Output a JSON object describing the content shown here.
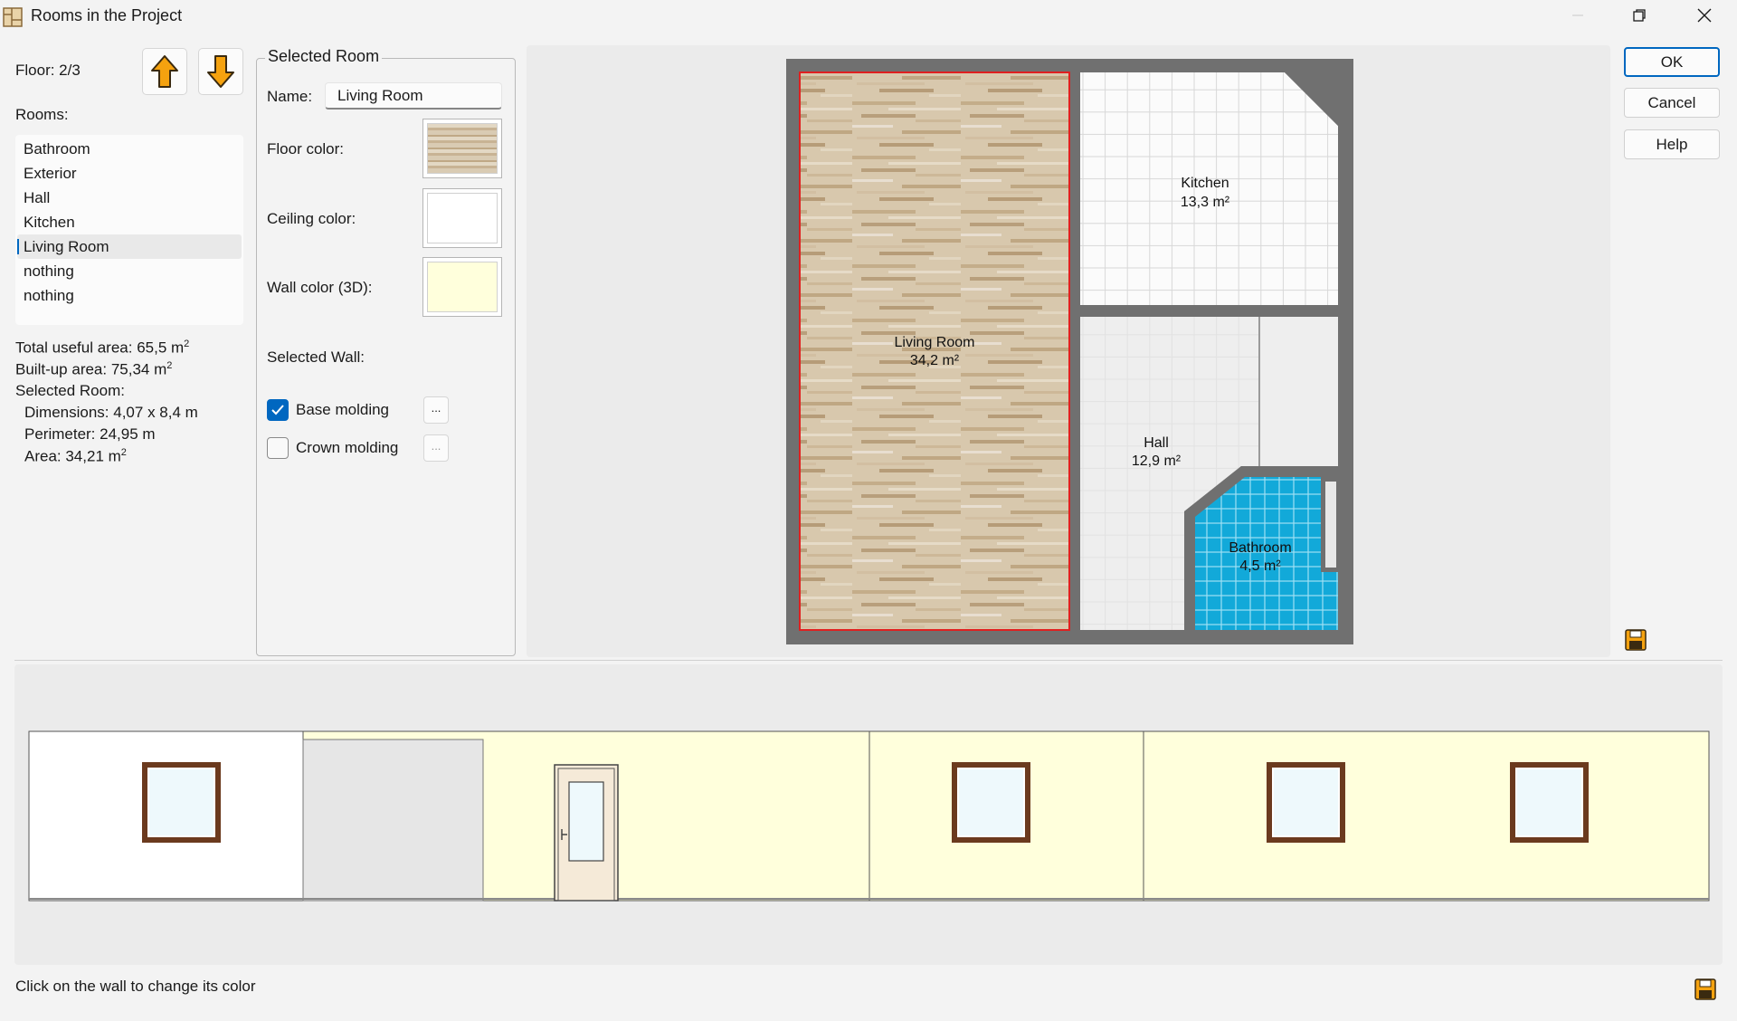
{
  "window": {
    "title": "Rooms in the Project"
  },
  "floor": {
    "label": "Floor: 2/3"
  },
  "rooms": {
    "label": "Rooms:",
    "items": [
      "Bathroom",
      "Exterior",
      "Hall",
      "Kitchen",
      "Living Room",
      "nothing",
      "nothing"
    ],
    "selected": "Living Room"
  },
  "stats": {
    "total_useful_area": "Total useful area: 65,5 m",
    "built_up_area": "Built-up area: 75,34 m",
    "selected_room": "Selected Room:",
    "dimensions": "Dimensions: 4,07 x 8,4 m",
    "perimeter": "Perimeter: 24,95 m",
    "area": "Area: 34,21 m",
    "sq": "2"
  },
  "selected_room": {
    "legend": "Selected Room",
    "name_label": "Name:",
    "name_value": "Living Room",
    "floor_color_label": "Floor color:",
    "ceiling_color_label": "Ceiling color:",
    "wall_color_label": "Wall color (3D):",
    "selected_wall_label": "Selected Wall:",
    "base_molding_label": "Base molding",
    "base_molding_checked": true,
    "crown_molding_label": "Crown molding",
    "crown_molding_checked": false,
    "dots_label": "...",
    "ceiling_color": "#ffffff",
    "wall_color": "#ffffdc"
  },
  "plan": {
    "rooms": [
      {
        "name": "Living Room",
        "area": "34,2 m²"
      },
      {
        "name": "Kitchen",
        "area": "13,3 m²"
      },
      {
        "name": "Hall",
        "area": "12,9 m²"
      },
      {
        "name": "Bathroom",
        "area": "4,5 m²"
      }
    ]
  },
  "buttons": {
    "ok": "OK",
    "cancel": "Cancel",
    "help": "Help"
  },
  "status": "Click on the wall to change its color",
  "colors": {
    "accent": "#0067c0",
    "wall_yellow": "#ffffdc",
    "bathroom_tile": "#12a9d9",
    "selection_red": "#e02020",
    "arrow_orange": "#f5a20f"
  },
  "icons": {
    "up": "arrow-up-icon",
    "down": "arrow-down-icon",
    "save": "save-icon",
    "close": "close-icon",
    "restore": "restore-icon",
    "minimize": "minimize-icon"
  }
}
